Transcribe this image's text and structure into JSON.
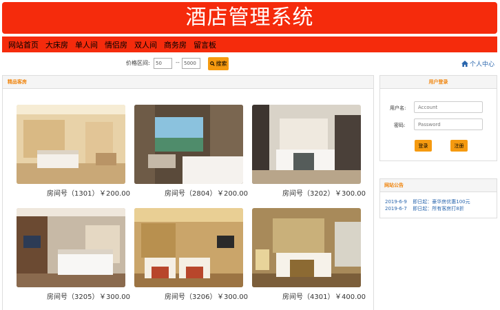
{
  "header": {
    "title": "酒店管理系统"
  },
  "nav": {
    "items": [
      "网站首页",
      "大床房",
      "单人间",
      "情侣房",
      "双人间",
      "商务房",
      "留言板"
    ]
  },
  "search": {
    "label": "价格区间:",
    "min_value": "50",
    "separator": "--",
    "max_value": "5000",
    "button_label": "搜索",
    "user_center": "个人中心"
  },
  "rooms_panel": {
    "title": "精品客房",
    "rooms": [
      {
        "number": "房间号（1301）",
        "price": "￥200.00"
      },
      {
        "number": "房间号（2804）",
        "price": "￥200.00"
      },
      {
        "number": "房间号（3202）",
        "price": "￥300.00"
      },
      {
        "number": "房间号（3205）",
        "price": "￥300.00"
      },
      {
        "number": "房间号（3206）",
        "price": "￥300.00"
      },
      {
        "number": "房间号（4301）",
        "price": "￥400.00"
      }
    ]
  },
  "login": {
    "title": "用户登录",
    "username_label": "用户名:",
    "username_placeholder": "Account",
    "password_label": "密码:",
    "password_placeholder": "Password",
    "login_button": "登录",
    "register_button": "注册"
  },
  "notice": {
    "title": "网站公告",
    "items": [
      {
        "date": "2019-6-9",
        "text": "即日起：豪华房优惠100元"
      },
      {
        "date": "2019-6-7",
        "text": "即日起：所有客房打8折"
      }
    ]
  },
  "colors": {
    "brand_red": "#f52b0c",
    "accent_orange": "#f59a10",
    "link_blue": "#2a66ad"
  }
}
